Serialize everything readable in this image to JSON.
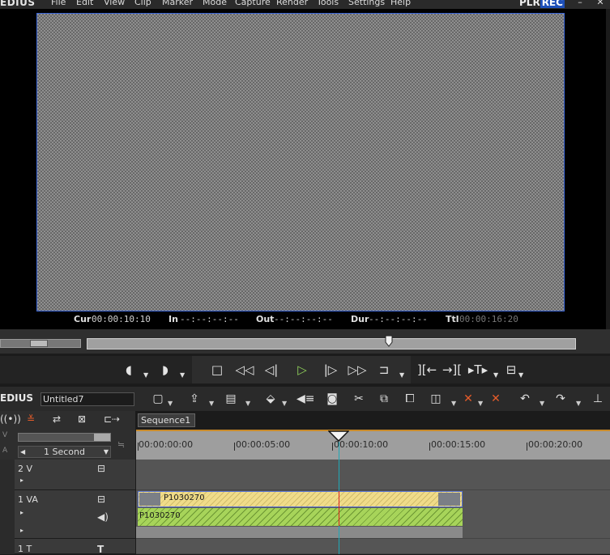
{
  "menu": {
    "logo": "EDIUS",
    "items": [
      "File",
      "Edit",
      "View",
      "Clip",
      "Marker",
      "Mode",
      "Capture",
      "Render",
      "Tools",
      "Settings",
      "Help"
    ],
    "plr": "PLR",
    "rec": "REC",
    "window_controls": [
      "minimize-icon",
      "close-icon"
    ]
  },
  "monitor": {
    "timecodes": {
      "cur_label": "Cur",
      "cur_value": "00:00:10:10",
      "in_label": "In",
      "in_value": "--:--:--:--",
      "out_label": "Out",
      "out_value": "--:--:--:--",
      "dur_label": "Dur",
      "dur_value": "--:--:--:--",
      "ttl_label": "Ttl",
      "ttl_value": "00:00:16:20"
    }
  },
  "transport": {
    "buttons": [
      "set-in-icon",
      "set-out-icon",
      "stop-icon",
      "rewind-icon",
      "step-back-icon",
      "play-icon",
      "step-forward-icon",
      "fast-forward-icon",
      "loop-icon",
      "insert-to-timeline-icon",
      "overwrite-to-timeline-icon",
      "trim-icon",
      "tools-icon"
    ]
  },
  "timeline": {
    "logo": "EDIUS",
    "project_name": "Untitled7",
    "sequence_tab": "Sequence1",
    "zoom_label": "1 Second",
    "ruler_labels": [
      "00:00:00:00",
      "00:00:05:00",
      "00:00:10:00",
      "00:00:15:00",
      "00:00:20:00"
    ],
    "tracks": [
      {
        "name": "2 V"
      },
      {
        "name": "1 VA"
      },
      {
        "name": "1 T"
      }
    ],
    "clip_video_label": "P1030270",
    "clip_audio_label": "P1030270",
    "colors": {
      "accent": "#3b66d6",
      "video_clip": "#f0dc8a",
      "audio_clip": "#a7d45a",
      "playhead": "#1fa9b8"
    }
  }
}
